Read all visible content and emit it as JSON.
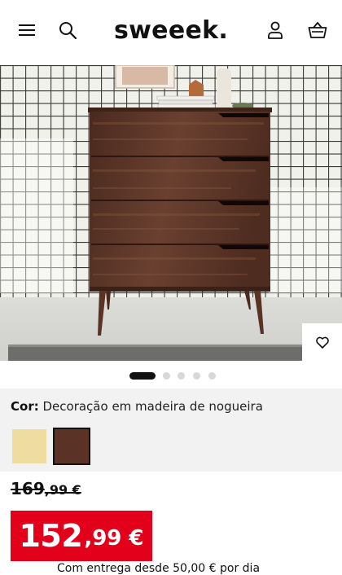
{
  "header": {
    "logo": "sweeek.",
    "icons": [
      "menu-icon",
      "search-icon",
      "account-icon",
      "basket-icon"
    ]
  },
  "gallery": {
    "slide_count": 5,
    "active_index": 0
  },
  "color": {
    "label": "Cor:",
    "value": "Decoração em madeira de nogueira",
    "swatches": [
      {
        "name": "light-wood",
        "hex": "#efdca0",
        "selected": false
      },
      {
        "name": "walnut",
        "hex": "#5a3326",
        "selected": true
      }
    ]
  },
  "price": {
    "old_int": "169",
    "old_dec": ",99 €",
    "new_int": "152",
    "new_dec": ",99 €",
    "accent": "#e3001b"
  },
  "shipping_text": "Com entrega desde 50,00 € por dia"
}
